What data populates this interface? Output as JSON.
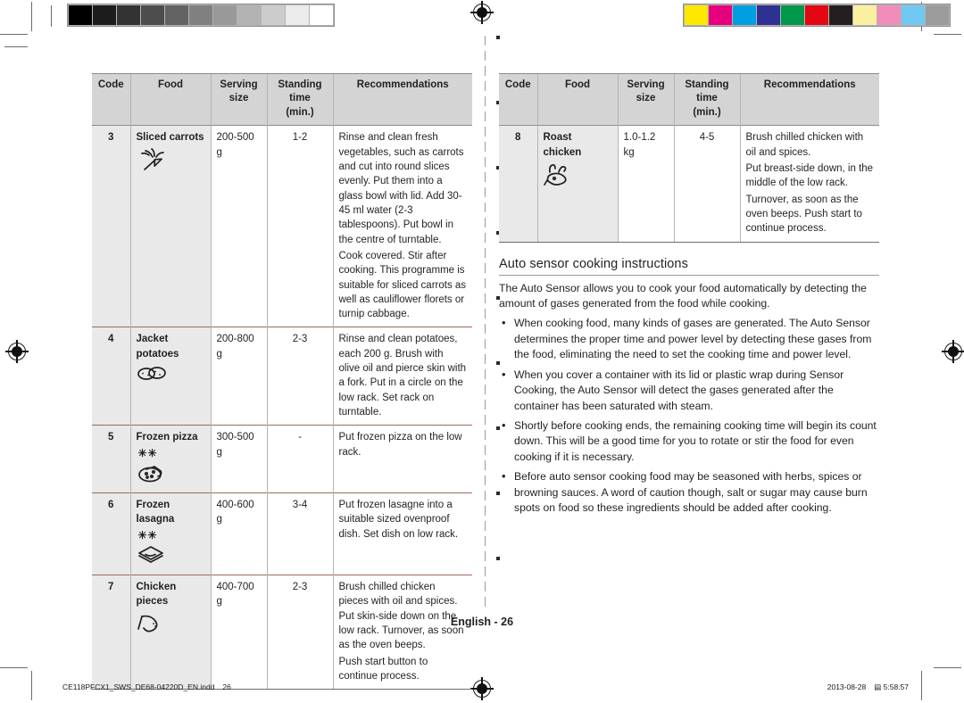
{
  "printer_marks": {
    "grayscale_swatches": [
      "#000000",
      "#1c1c1c",
      "#333333",
      "#4d4d4d",
      "#636363",
      "#808080",
      "#999999",
      "#b3b3b3",
      "#cccccc",
      "#ebebeb",
      "#ffffff"
    ],
    "color_swatches": [
      "#ffe800",
      "#e6007e",
      "#009fe3",
      "#2e3192",
      "#00984a",
      "#e30613",
      "#231f20",
      "#fbf0a0",
      "#f08dbb",
      "#6fc9f2",
      "#9b9b9b"
    ],
    "registration_mark": "registration-target"
  },
  "tables": {
    "headers": [
      "Code",
      "Food",
      "Serving size",
      "Standing time (min.)",
      "Recommendations"
    ],
    "header_lines": {
      "code": "Code",
      "food": "Food",
      "serving_1": "Serving",
      "serving_2": "size",
      "standing_1": "Standing",
      "standing_2": "time",
      "standing_3": "(min.)",
      "recommendations": "Recommendations"
    },
    "left_rows": [
      {
        "code": "3",
        "food": "Sliced carrots",
        "icon": "carrot-icon",
        "stars": "",
        "serving": "200-500 g",
        "standing": "1-2",
        "recommendations": [
          "Rinse and clean fresh vegetables, such as carrots and cut into round slices evenly. Put them into a glass bowl with lid. Add 30-45 ml water (2-3 tablespoons). Put bowl in the centre of turntable.",
          "Cook covered. Stir after cooking. This programme is suitable for sliced carrots as well as cauliflower florets or turnip cabbage."
        ]
      },
      {
        "code": "4",
        "food": "Jacket potatoes",
        "icon": "potatoes-icon",
        "stars": "",
        "serving": "200-800 g",
        "standing": "2-3",
        "recommendations": [
          "Rinse and clean potatoes, each 200 g. Brush with olive oil and pierce skin with a fork. Put in a circle on the low rack. Set rack on turntable."
        ]
      },
      {
        "code": "5",
        "food": "Frozen pizza",
        "icon": "pizza-icon",
        "stars": "✳✳",
        "serving": "300-500 g",
        "standing": "-",
        "recommendations": [
          "Put frozen pizza on the low rack."
        ]
      },
      {
        "code": "6",
        "food": "Frozen lasagna",
        "icon": "lasagna-icon",
        "stars": "✳✳",
        "serving": "400-600 g",
        "standing": "3-4",
        "recommendations": [
          "Put frozen lasagne into a suitable sized ovenproof dish. Set dish on low rack."
        ]
      },
      {
        "code": "7",
        "food": "Chicken pieces",
        "icon": "chicken-piece-icon",
        "stars": "",
        "serving": "400-700 g",
        "standing": "2-3",
        "recommendations": [
          "Brush chilled chicken pieces with oil and spices. Put skin-side down on the low rack. Turnover, as soon as the oven beeps.",
          "Push start button to continue process."
        ]
      }
    ],
    "right_rows": [
      {
        "code": "8",
        "food": "Roast chicken",
        "icon": "roast-chicken-icon",
        "stars": "",
        "serving": "1.0-1.2 kg",
        "standing": "4-5",
        "recommendations": [
          "Brush chilled chicken with oil and spices.",
          "Put breast-side down, in the middle of the low rack.",
          "Turnover, as soon as the oven beeps. Push start to continue process."
        ]
      }
    ]
  },
  "section": {
    "title": "Auto sensor cooking instructions",
    "intro": "The Auto Sensor allows you to cook your food automatically by detecting the amount of gases generated from the food while cooking.",
    "bullets": [
      "When cooking food, many kinds of gases are generated. The Auto Sensor determines the proper time and power level by detecting these gases from the food, eliminating the need to set the cooking time and power level.",
      "When you cover a container with its lid or plastic wrap during Sensor Cooking, the Auto Sensor will detect the gases generated after the container has been saturated with steam.",
      "Shortly before cooking ends, the remaining cooking time will begin its count down. This will be a good time for you to rotate or stir the food for even cooking if it is necessary.",
      "Before auto sensor cooking food may be seasoned with herbs, spices or browning sauces. A word of caution though, salt or sugar may cause burn spots on food so these ingredients should be added after cooking."
    ]
  },
  "footer": {
    "page_label": "English - 26",
    "file_name": "CE118PFCX1_SWS_DE68-04220D_EN.indd",
    "file_page": "26",
    "date": "2013-08-28",
    "meridiem": "▤",
    "time": "5:58:57"
  }
}
